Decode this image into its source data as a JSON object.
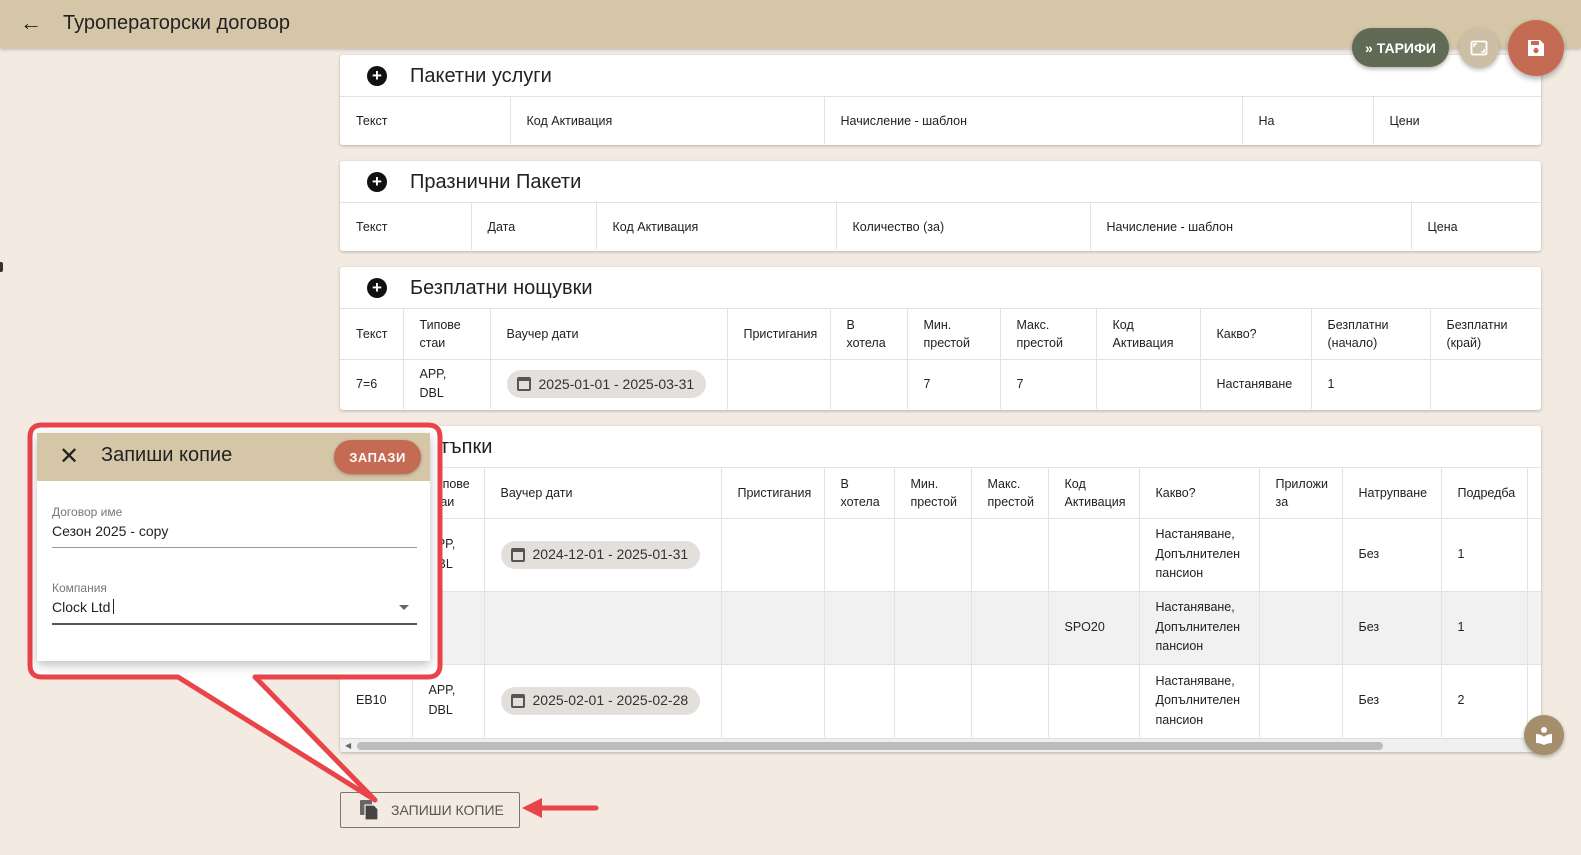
{
  "header": {
    "title": "Туроператорски договор"
  },
  "actions": {
    "tariffs_label": "ТАРИФИ"
  },
  "sections": {
    "package_services": {
      "title": "Пакетни услуги",
      "columns": [
        "Текст",
        "Код Активация",
        "Начисление - шаблон",
        "На",
        "Цени"
      ]
    },
    "holiday_packages": {
      "title": "Празнични Пакети",
      "columns": [
        "Текст",
        "Дата",
        "Код Активация",
        "Количество (за)",
        "Начисление - шаблон",
        "Цена"
      ]
    },
    "free_nights": {
      "title": "Безплатни нощувки",
      "columns": [
        "Текст",
        "Типове стаи",
        "Ваучер дати",
        "Пристигания",
        "В хотела",
        "Мин. престой",
        "Макс. престой",
        "Код Активация",
        "Какво?",
        "Безплатни (начало)",
        "Безплатни (край)"
      ],
      "rows": [
        {
          "text": "7=6",
          "room_types": "APP, DBL",
          "voucher_dates": "2025-01-01 - 2025-03-31",
          "arrivals": "",
          "in_hotel": "",
          "min_stay": "7",
          "max_stay": "7",
          "code": "",
          "what": "Настаняване",
          "free_start": "1",
          "free_end": ""
        }
      ]
    },
    "discounts": {
      "title_visible": "стъпки",
      "columns": [
        "Типове стаи",
        "Ваучер дати",
        "Пристигания",
        "В хотела",
        "Мин. престой",
        "Макс. престой",
        "Код Активация",
        "Какво?",
        "Приложи за",
        "Натрупване",
        "Подредба"
      ],
      "rows": [
        {
          "text": "",
          "room_types": "APP, DBL",
          "voucher_dates": "2024-12-01 - 2025-01-31",
          "arrivals": "",
          "in_hotel": "",
          "min_stay": "",
          "max_stay": "",
          "code": "",
          "what": "Настаняване, Допълнителен пансион",
          "apply_for": "",
          "accumulation": "Без",
          "order": "1"
        },
        {
          "text": "",
          "room_types": "",
          "voucher_dates": "",
          "arrivals": "",
          "in_hotel": "",
          "min_stay": "",
          "max_stay": "",
          "code": "SPO20",
          "what": "Настаняване, Допълнителен пансион",
          "apply_for": "",
          "accumulation": "Без",
          "order": "1"
        },
        {
          "text": "EB10",
          "room_types": "APP, DBL",
          "voucher_dates": "2025-02-01 - 2025-02-28",
          "arrivals": "",
          "in_hotel": "",
          "min_stay": "",
          "max_stay": "",
          "code": "",
          "what": "Настаняване, Допълнителен пансион",
          "apply_for": "",
          "accumulation": "Без",
          "order": "2"
        }
      ]
    }
  },
  "copy_button": {
    "label": "ЗАПИШИ КОПИЕ"
  },
  "dialog": {
    "title": "Запиши копие",
    "save_label": "ЗАПАЗИ",
    "contract_name": {
      "label": "Договор име",
      "value": "Сезон 2025 - copy"
    },
    "company": {
      "label": "Компания",
      "value": "Clock Ltd"
    }
  },
  "colors": {
    "topbar": "#d6c6a8",
    "background": "#f3ebe2",
    "accent_red": "#c56a53",
    "tariffs_green": "#5f6b55",
    "annotation_red": "#e8444a"
  }
}
